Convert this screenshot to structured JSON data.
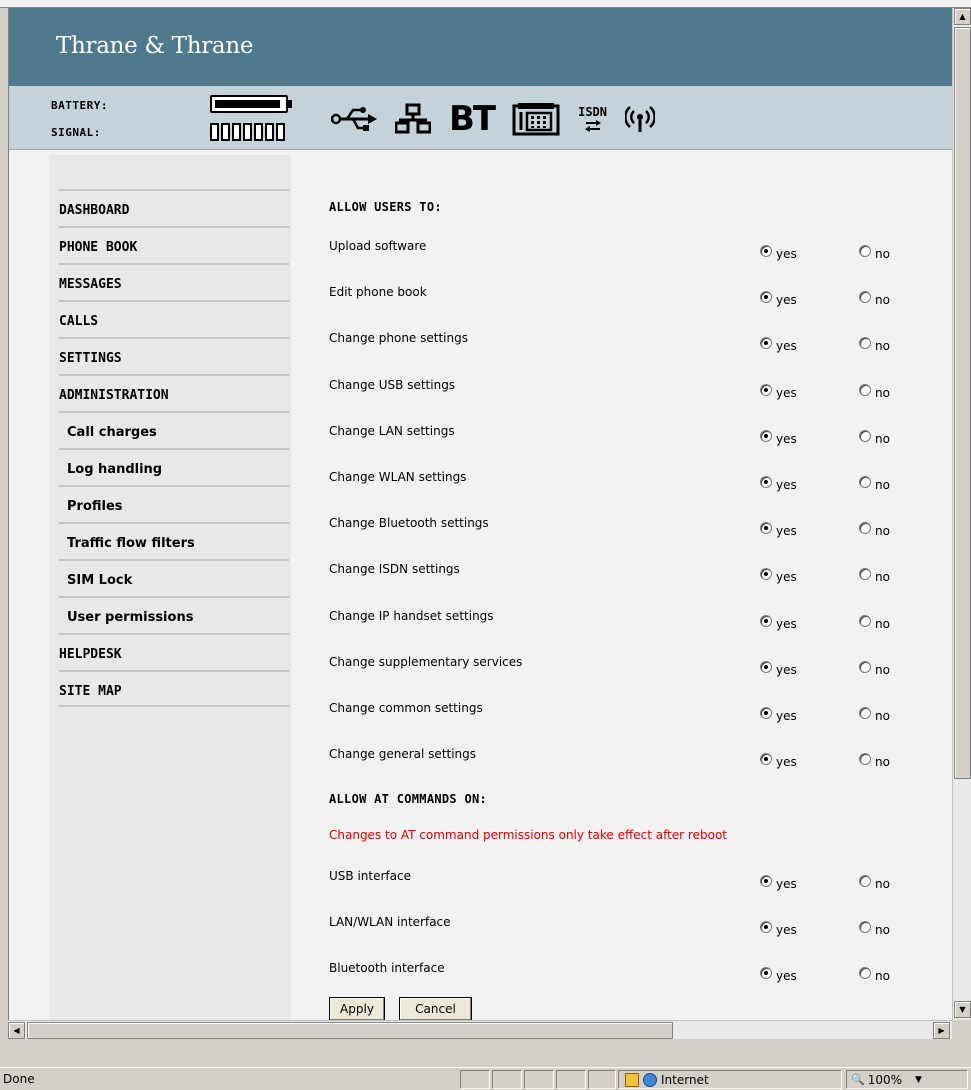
{
  "brand": {
    "name": "Thrane & Thrane"
  },
  "status": {
    "battery_label": "BATTERY:",
    "signal_label": "SIGNAL:",
    "battery_level": 0.95,
    "signal_bars_total": 7,
    "signal_bars_lit": 0,
    "interfaces": [
      "usb-icon",
      "lan-icon",
      "bluetooth-icon",
      "phone-icon",
      "isdn-icon",
      "wlan-icon"
    ],
    "bt_text": "BT",
    "isdn_text": "ISDN"
  },
  "nav": {
    "items": [
      {
        "label": "DASHBOARD",
        "sub": false
      },
      {
        "label": "PHONE BOOK",
        "sub": false
      },
      {
        "label": "MESSAGES",
        "sub": false
      },
      {
        "label": "CALLS",
        "sub": false
      },
      {
        "label": "SETTINGS",
        "sub": false
      },
      {
        "label": "ADMINISTRATION",
        "sub": false
      },
      {
        "label": "Call charges",
        "sub": true
      },
      {
        "label": "Log handling",
        "sub": true
      },
      {
        "label": "Profiles",
        "sub": true
      },
      {
        "label": "Traffic flow filters",
        "sub": true
      },
      {
        "label": "SIM Lock",
        "sub": true
      },
      {
        "label": "User permissions",
        "sub": true
      },
      {
        "label": "HELPDESK",
        "sub": false
      },
      {
        "label": "SITE MAP",
        "sub": false
      }
    ]
  },
  "permissions": {
    "heading": "ALLOW USERS TO:",
    "yes_label": "yes",
    "no_label": "no",
    "rows": [
      {
        "label": "Upload software",
        "value": "yes"
      },
      {
        "label": "Edit phone book",
        "value": "yes"
      },
      {
        "label": "Change phone settings",
        "value": "yes"
      },
      {
        "label": "Change USB settings",
        "value": "yes"
      },
      {
        "label": "Change LAN settings",
        "value": "yes"
      },
      {
        "label": "Change WLAN settings",
        "value": "yes"
      },
      {
        "label": "Change Bluetooth settings",
        "value": "yes"
      },
      {
        "label": "Change ISDN settings",
        "value": "yes"
      },
      {
        "label": "Change IP handset settings",
        "value": "yes"
      },
      {
        "label": "Change supplementary services",
        "value": "yes"
      },
      {
        "label": "Change common settings",
        "value": "yes"
      },
      {
        "label": "Change general settings",
        "value": "yes"
      }
    ]
  },
  "at_commands": {
    "heading": "ALLOW AT COMMANDS ON:",
    "warning": "Changes to AT command permissions only take effect after reboot",
    "rows": [
      {
        "label": "USB interface",
        "value": "yes"
      },
      {
        "label": "LAN/WLAN interface",
        "value": "yes"
      },
      {
        "label": "Bluetooth interface",
        "value": "yes"
      }
    ]
  },
  "buttons": {
    "apply": "Apply",
    "cancel": "Cancel"
  },
  "browser": {
    "status_text": "Done",
    "zone": "Internet",
    "zoom": "100%"
  },
  "colors": {
    "brand_bar": "#4f7a8e",
    "status_bar": "#c5d2d9",
    "warning": "#e00000"
  }
}
